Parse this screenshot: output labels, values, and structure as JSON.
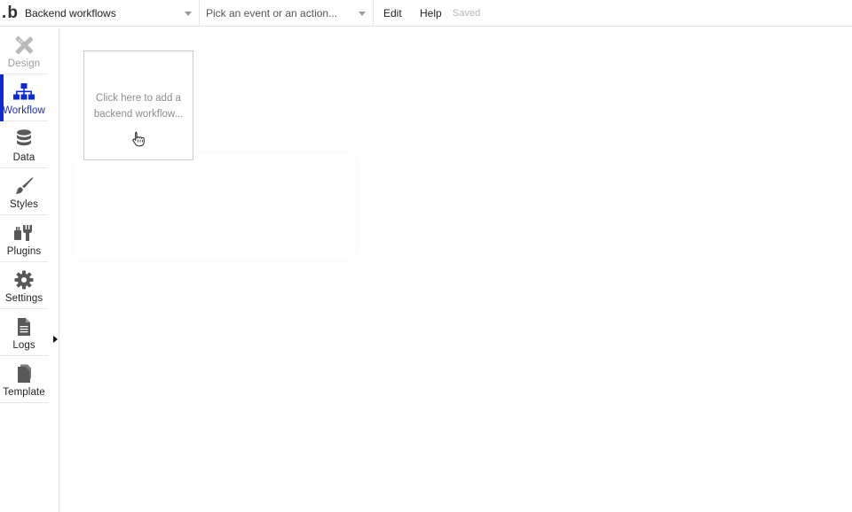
{
  "header": {
    "logo_text": "b",
    "logo_dot": ".",
    "page_select": {
      "value": "Backend workflows",
      "icon": "chevron-down-icon"
    },
    "event_select": {
      "value": "Pick an event or an action...",
      "icon": "chevron-down-icon"
    },
    "menu": [
      {
        "label": "Edit"
      },
      {
        "label": "Help"
      }
    ],
    "status": "Saved"
  },
  "sidebar": {
    "items": [
      {
        "key": "design",
        "label": "Design",
        "icon": "design-pencil-ruler-icon",
        "state": "disabled"
      },
      {
        "key": "workflow",
        "label": "Workflow",
        "icon": "workflow-sitemap-icon",
        "state": "active"
      },
      {
        "key": "data",
        "label": "Data",
        "icon": "database-icon",
        "state": "normal"
      },
      {
        "key": "styles",
        "label": "Styles",
        "icon": "paintbrush-icon",
        "state": "normal"
      },
      {
        "key": "plugins",
        "label": "Plugins",
        "icon": "plug-icon",
        "state": "normal"
      },
      {
        "key": "settings",
        "label": "Settings",
        "icon": "gear-icon",
        "state": "normal"
      },
      {
        "key": "logs",
        "label": "Logs",
        "icon": "document-icon",
        "state": "normal"
      },
      {
        "key": "template",
        "label": "Template",
        "icon": "template-pages-icon",
        "state": "normal"
      }
    ],
    "collapse_icon": "collapse-arrow-icon"
  },
  "canvas": {
    "add_workflow_card": {
      "line1": "Click here to add a",
      "line2": "backend workflow...",
      "icon": "hand-pointer-cursor-icon"
    }
  },
  "colors": {
    "accent": "#0c2bd4",
    "active_label": "#1d2bc4",
    "icon_gray": "#595959",
    "disabled_gray": "#9d9d9d",
    "status_gray": "#b5b5b5"
  }
}
